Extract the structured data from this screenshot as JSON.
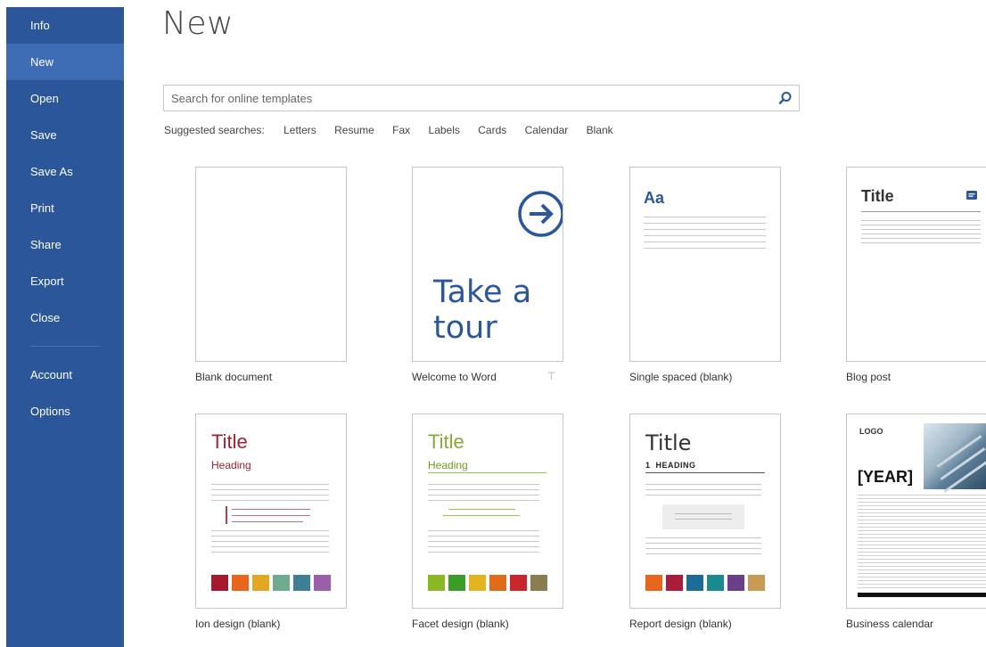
{
  "sidebar": {
    "items": [
      {
        "label": "Info"
      },
      {
        "label": "New",
        "active": true
      },
      {
        "label": "Open"
      },
      {
        "label": "Save"
      },
      {
        "label": "Save As"
      },
      {
        "label": "Print"
      },
      {
        "label": "Share"
      },
      {
        "label": "Export"
      },
      {
        "label": "Close"
      }
    ],
    "bottom_items": [
      {
        "label": "Account"
      },
      {
        "label": "Options"
      }
    ]
  },
  "page": {
    "title": "New"
  },
  "search": {
    "placeholder": "Search for online templates",
    "value": "",
    "icon": "search-icon"
  },
  "suggested": {
    "label": "Suggested searches:",
    "links": [
      "Letters",
      "Resume",
      "Fax",
      "Labels",
      "Cards",
      "Calendar",
      "Blank"
    ]
  },
  "templates": [
    {
      "name": "Blank document"
    },
    {
      "name": "Welcome to Word",
      "thumb_text": "Take a tour",
      "pinned_icon": "pin-icon"
    },
    {
      "name": "Single spaced (blank)",
      "thumb_text": "Aa"
    },
    {
      "name": "Blog post",
      "thumb_text": "Title"
    },
    {
      "name": "Ion design (blank)",
      "thumb_title": "Title",
      "thumb_heading": "Heading"
    },
    {
      "name": "Facet design (blank)",
      "thumb_title": "Title",
      "thumb_heading": "Heading"
    },
    {
      "name": "Report design (blank)",
      "thumb_title": "Title",
      "thumb_heading": "1  HEADING"
    },
    {
      "name": "Business calendar",
      "thumb_logo": "LOGO",
      "thumb_year": "[YEAR]"
    }
  ],
  "colors": {
    "sidebar_bg": "#2b579a",
    "sidebar_active": "#3e6db5",
    "accent_blue": "#2b579a",
    "ion_red": "#9b2335",
    "facet_green": "#84aa33",
    "ion_swatches": [
      "#a6192e",
      "#e8661b",
      "#e3a823",
      "#6fab8f",
      "#3f7f96",
      "#9b5ea9"
    ],
    "facet_swatches": [
      "#8ab825",
      "#3c9c2a",
      "#e4b41f",
      "#e06b18",
      "#c8282b",
      "#8b7d52"
    ],
    "report_swatches": [
      "#e8661b",
      "#a81e3a",
      "#1c6b99",
      "#1a8a8c",
      "#6b3f87",
      "#c79a55"
    ]
  }
}
